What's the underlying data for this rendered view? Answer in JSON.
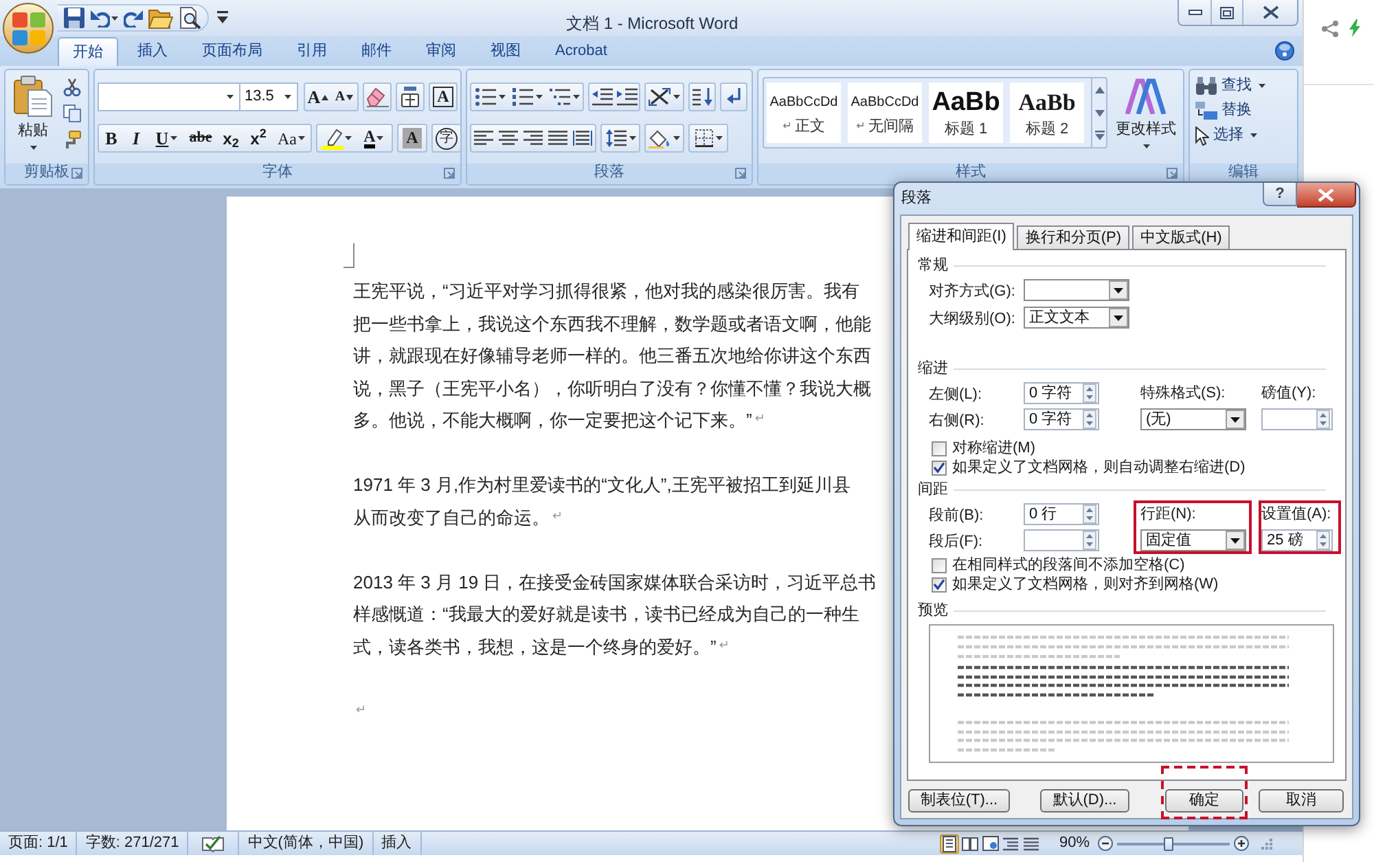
{
  "window": {
    "title": "文档 1 - Microsoft Word"
  },
  "tabs": [
    {
      "label": "开始",
      "selected": true
    },
    {
      "label": "插入",
      "selected": false
    },
    {
      "label": "页面布局",
      "selected": false
    },
    {
      "label": "引用",
      "selected": false
    },
    {
      "label": "邮件",
      "selected": false
    },
    {
      "label": "审阅",
      "selected": false
    },
    {
      "label": "视图",
      "selected": false
    },
    {
      "label": "Acrobat",
      "selected": false
    }
  ],
  "ribbon": {
    "clipboard": {
      "label": "剪贴板",
      "paste": "粘贴"
    },
    "font": {
      "label": "字体",
      "font_size": "13.5",
      "row_1": [
        {
          "kind": "grow",
          "glyph": "A"
        },
        {
          "kind": "shrink",
          "glyph": "A"
        },
        {
          "kind": "clear"
        },
        {
          "kind": "phonetic"
        },
        {
          "kind": "border",
          "glyph": "A"
        }
      ],
      "row_2": [
        {
          "kind": "bold",
          "glyph": "B"
        },
        {
          "kind": "italic",
          "glyph": "I"
        },
        {
          "kind": "underline",
          "glyph": "U"
        },
        {
          "kind": "strike",
          "glyph": "abe"
        },
        {
          "kind": "subscript",
          "glyph": "x$_{2}$"
        },
        {
          "kind": "superscript",
          "glyph": "x$^{2}$"
        },
        {
          "kind": "case",
          "glyph": "Aa"
        },
        {
          "kind": "highlight"
        },
        {
          "kind": "color",
          "glyph": "A"
        },
        {
          "kind": "shading",
          "glyph": "A"
        },
        {
          "kind": "enclose",
          "glyph": "字"
        }
      ]
    },
    "paragraph": {
      "label": "段落"
    },
    "styles": {
      "label": "样式",
      "items": [
        {
          "kind": "body",
          "sample": "AaBbCcDd",
          "mark": "↵",
          "name": "正文"
        },
        {
          "kind": "body",
          "sample": "AaBbCcDd",
          "mark": "↵",
          "name": "无间隔"
        },
        {
          "kind": "heading_1",
          "sample": "AaBb",
          "name": "标题 1"
        },
        {
          "kind": "heading_2",
          "sample": "AaBb",
          "name": "标题 2"
        }
      ],
      "change_styles": "更改样式"
    },
    "editing": {
      "label": "编辑",
      "items": [
        {
          "kind": "find",
          "label": "查找"
        },
        {
          "kind": "replace",
          "label": "替换"
        },
        {
          "kind": "select",
          "label": "选择"
        }
      ]
    }
  },
  "document": {
    "paragraphs": [
      {
        "lines": [
          "王宪平说，“习近平对学习抓得很紧，他对我的感染很厉害。我有",
          "把一些书拿上，我说这个东西我不理解，数学题或者语文啊，他能",
          "讲，就跟现在好像辅导老师一样的。他三番五次地给你讲这个东西",
          "说，黑子（王宪平小名），你听明白了没有？你懂不懂？我说大概",
          "多。他说，不能大概啊，你一定要把这个记下来。”"
        ],
        "end_mark": "↵"
      },
      {
        "lines": [
          "1971 年 3 月,作为村里爱读书的“文化人”,王宪平被招工到延川县",
          "从而改变了自己的命运。"
        ],
        "end_mark": "↵"
      },
      {
        "lines": [
          "2013 年 3 月 19 日，在接受金砖国家媒体联合采访时，习近平总书",
          "样感慨道：“我最大的爱好就是读书，读书已经成为自己的一种生",
          "式，读各类书，我想，这是一个终身的爱好。”"
        ],
        "end_mark": "↵"
      },
      {
        "end_mark": "↵"
      }
    ]
  },
  "dialog": {
    "title": "段落",
    "help": "?",
    "tabs": [
      {
        "label": "缩进和间距(I)",
        "selected": true
      },
      {
        "label": "换行和分页(P)",
        "selected": false
      },
      {
        "label": "中文版式(H)",
        "selected": false
      }
    ],
    "general": {
      "heading": "常规",
      "alignment": {
        "label": "对齐方式(G):"
      },
      "outline_level": {
        "label": "大纲级别(O):",
        "value": "正文文本"
      }
    },
    "indentation": {
      "heading": "缩进",
      "left": {
        "label": "左侧(L):",
        "value": "0 字符"
      },
      "right": {
        "label": "右侧(R):",
        "value": "0 字符"
      },
      "special": {
        "label": "特殊格式(S):",
        "value": "(无)"
      },
      "by": {
        "label": "磅值(Y):"
      },
      "options": [
        {
          "label": "对称缩进(M)",
          "checked": false
        },
        {
          "label": "如果定义了文档网格，则自动调整右缩进(D)",
          "checked": true
        }
      ]
    },
    "spacing": {
      "heading": "间距",
      "before": {
        "label": "段前(B):",
        "value": "0 行"
      },
      "after": {
        "label": "段后(F):"
      },
      "line_spacing": {
        "label": "行距(N):",
        "value": "固定值",
        "highlighted": true
      },
      "at": {
        "label": "设置值(A):",
        "value": "25 磅",
        "highlighted": true
      },
      "options": [
        {
          "label": "在相同样式的段落间不添加空格(C)",
          "checked": false
        },
        {
          "label": "如果定义了文档网格，则对齐到网格(W)",
          "checked": true
        }
      ]
    },
    "preview": {
      "heading": "预览"
    },
    "buttons": [
      {
        "label": "制表位(T)...",
        "highlighted": false
      },
      {
        "label": "默认(D)...",
        "highlighted": false
      },
      {
        "label": "确定",
        "highlighted": true
      },
      {
        "label": "取消",
        "highlighted": false
      }
    ]
  },
  "status_bar": {
    "items": [
      {
        "kind": "text",
        "text": "页面: 1/1"
      },
      {
        "kind": "text",
        "text": "字数: 271/271"
      },
      {
        "kind": "proofing"
      },
      {
        "kind": "text",
        "text": "中文(简体，中国)"
      },
      {
        "kind": "text",
        "text": "插入"
      }
    ],
    "views": [
      {
        "selected": true
      },
      {
        "selected": false
      },
      {
        "selected": false
      },
      {
        "selected": false
      },
      {
        "selected": false
      }
    ],
    "zoom": "90%",
    "zoom_slider": {
      "level": 0.45
    }
  }
}
